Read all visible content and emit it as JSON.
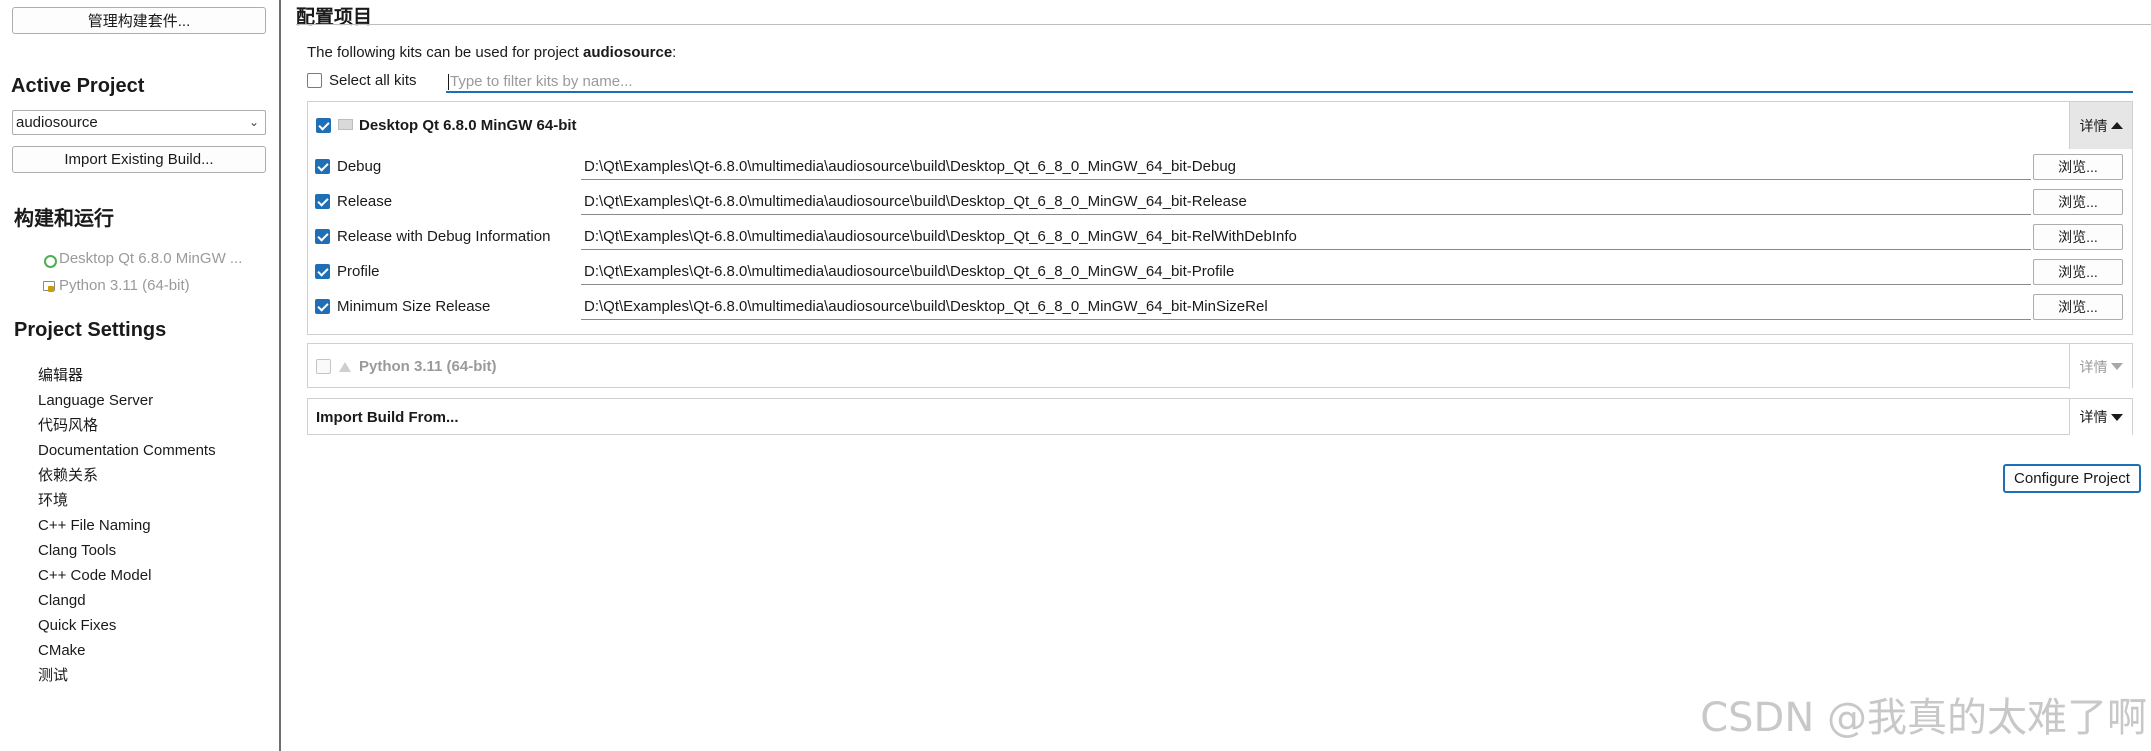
{
  "sidebar": {
    "manage_kits_label": "管理构建套件...",
    "active_project_heading": "Active Project",
    "project_select_value": "audiosource",
    "import_existing_build_label": "Import Existing Build...",
    "build_run_heading": "构建和运行",
    "kits": [
      {
        "label": "Desktop Qt 6.8.0 MinGW ...",
        "icon": "desktop-kit-icon"
      },
      {
        "label": "Python 3.11 (64-bit)",
        "icon": "python-kit-icon"
      }
    ],
    "project_settings_heading": "Project Settings",
    "settings_items": [
      "编辑器",
      "Language Server",
      "代码风格",
      "Documentation Comments",
      "依赖关系",
      "环境",
      "C++ File Naming",
      "Clang Tools",
      "C++ Code Model",
      "Clangd",
      "Quick Fixes",
      "CMake",
      "测试"
    ]
  },
  "main": {
    "title": "配置项目",
    "intro_prefix": "The following kits can be used for project ",
    "intro_project": "audiosource",
    "intro_suffix": ":",
    "select_all_label": "Select all kits",
    "filter_placeholder": "Type to filter kits by name...",
    "kit_desktop": {
      "label": "Desktop Qt 6.8.0 MinGW 64-bit",
      "details_label": "详情",
      "configs": [
        {
          "name": "Debug",
          "path": "D:\\Qt\\Examples\\Qt-6.8.0\\multimedia\\audiosource\\build\\Desktop_Qt_6_8_0_MinGW_64_bit-Debug",
          "browse": "浏览..."
        },
        {
          "name": "Release",
          "path": "D:\\Qt\\Examples\\Qt-6.8.0\\multimedia\\audiosource\\build\\Desktop_Qt_6_8_0_MinGW_64_bit-Release",
          "browse": "浏览..."
        },
        {
          "name": "Release with Debug Information",
          "path": "D:\\Qt\\Examples\\Qt-6.8.0\\multimedia\\audiosource\\build\\Desktop_Qt_6_8_0_MinGW_64_bit-RelWithDebInfo",
          "browse": "浏览..."
        },
        {
          "name": "Profile",
          "path": "D:\\Qt\\Examples\\Qt-6.8.0\\multimedia\\audiosource\\build\\Desktop_Qt_6_8_0_MinGW_64_bit-Profile",
          "browse": "浏览..."
        },
        {
          "name": "Minimum Size Release",
          "path": "D:\\Qt\\Examples\\Qt-6.8.0\\multimedia\\audiosource\\build\\Desktop_Qt_6_8_0_MinGW_64_bit-MinSizeRel",
          "browse": "浏览..."
        }
      ]
    },
    "kit_python": {
      "label": "Python 3.11 (64-bit)",
      "details_label": "详情"
    },
    "import_build": {
      "label": "Import Build From...",
      "details_label": "详情"
    },
    "configure_label": "Configure Project"
  },
  "watermark": "CSDN @我真的太难了啊",
  "colors": {
    "accent": "#1f6fb6",
    "divider": "#6e6e6e",
    "disabled_text": "#9a9a9a"
  }
}
